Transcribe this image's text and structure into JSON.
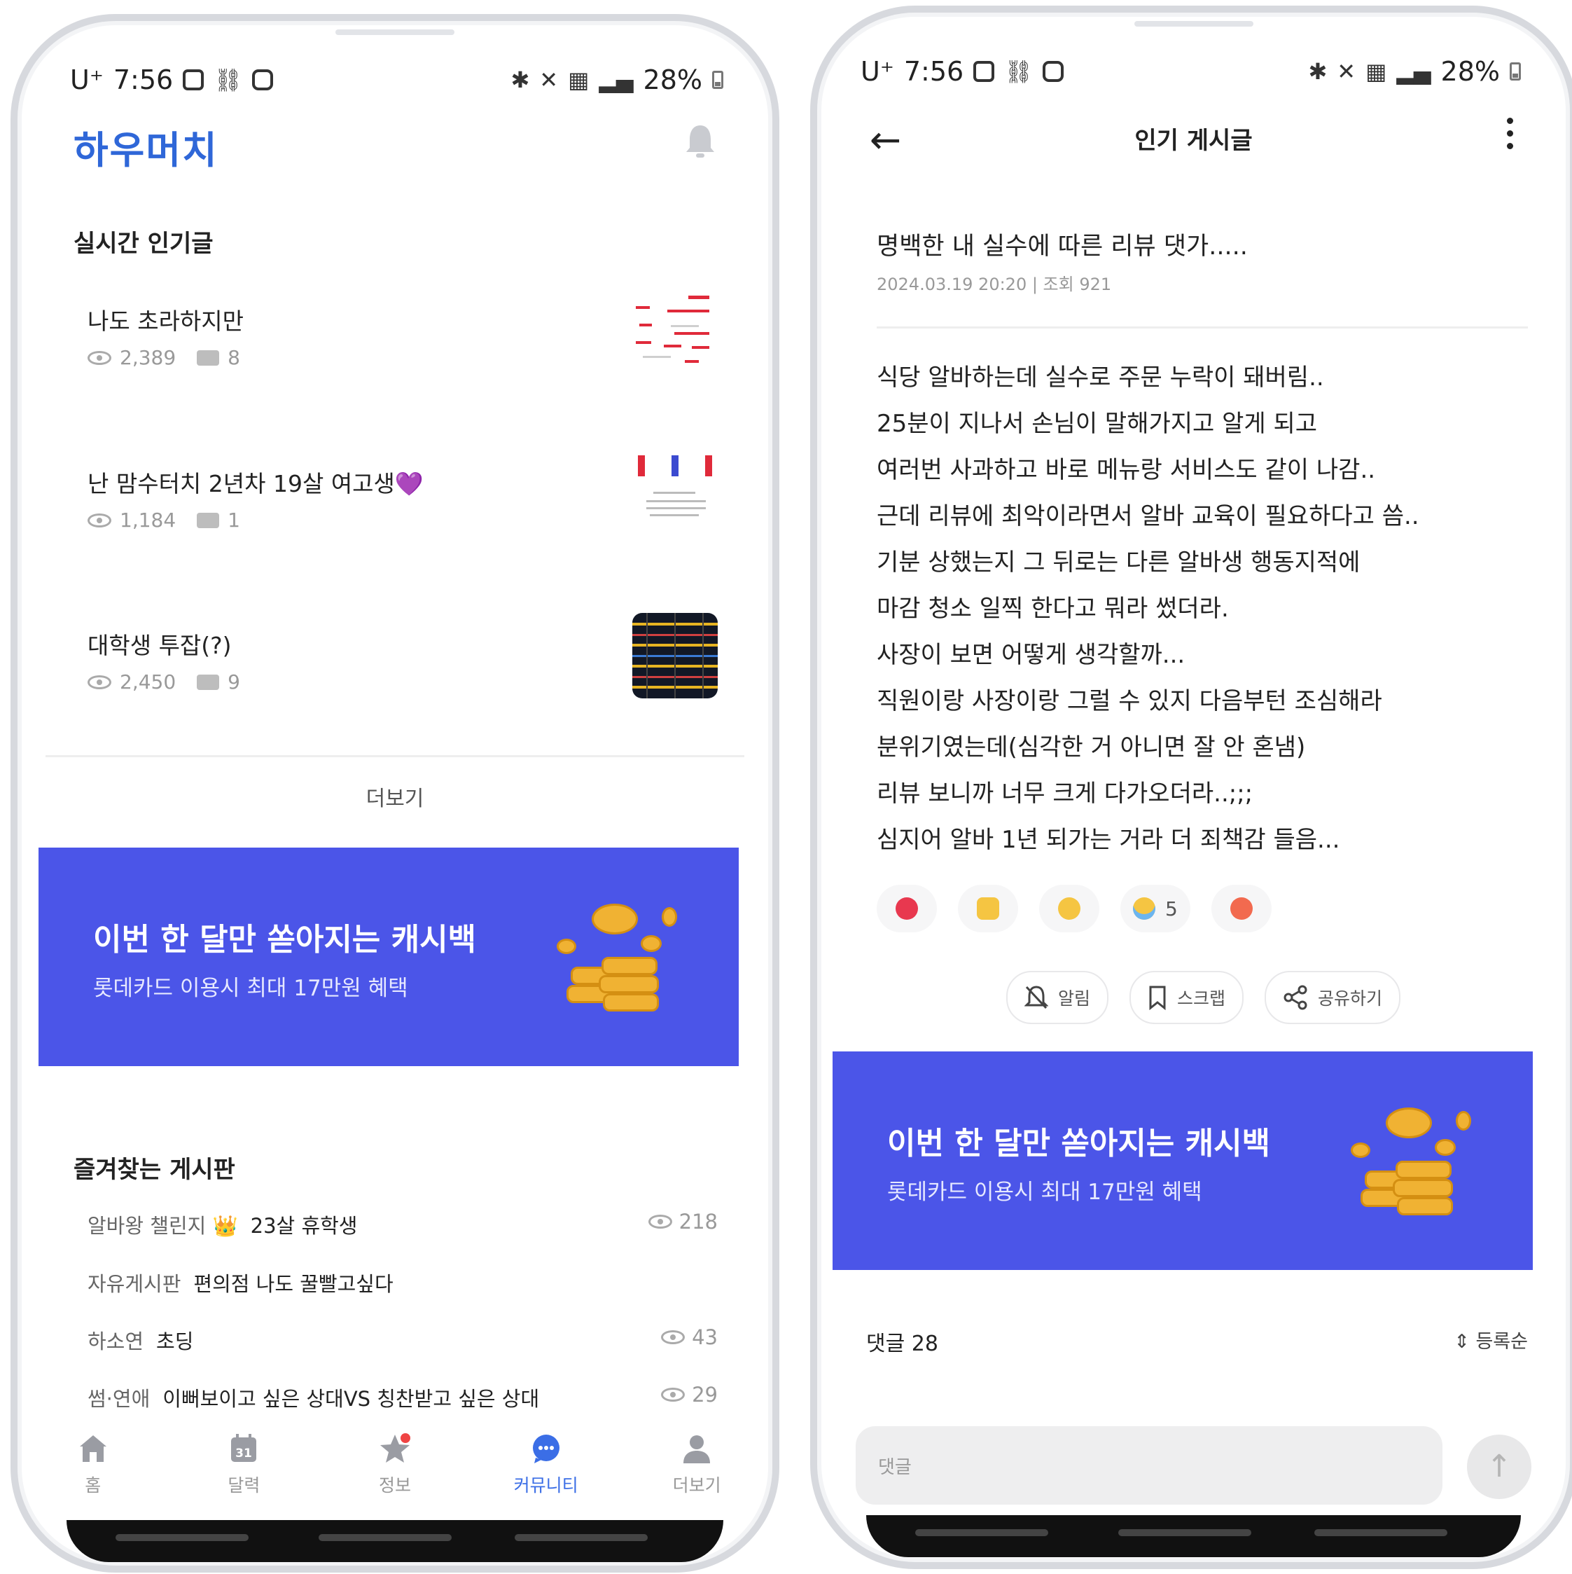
{
  "left": {
    "status": {
      "time": "7:56",
      "carrier": "U⁺",
      "battery": "28%"
    },
    "brand": "하우머치",
    "realtime": {
      "title": "실시간 인기글",
      "posts": [
        {
          "title": "나도 초라하지만",
          "views": "2,389",
          "comments": "8"
        },
        {
          "title": "난 맘수터치 2년차 19살 여고생💜",
          "views": "1,184",
          "comments": "1"
        },
        {
          "title": "대학생 투잡(?)",
          "views": "2,450",
          "comments": "9"
        }
      ],
      "more": "더보기"
    },
    "banner": {
      "title": "이번 한 달만 쏟아지는 캐시백",
      "subtitle": "롯데카드 이용시 최대 17만원 혜택"
    },
    "favorites": {
      "title": "즐겨찾는 게시판",
      "rows": [
        {
          "board": "알바왕 챌린지 👑",
          "title": "23살 휴학생",
          "views": "218"
        },
        {
          "board": "자유게시판",
          "title": "편의점 나도 꿀빨고싶다",
          "views": ""
        },
        {
          "board": "하소연",
          "title": "초딩",
          "views": "43"
        },
        {
          "board": "썸·연애",
          "title": "이뻐보이고 싶은 상대VS 칭찬받고 싶은 상대",
          "views": "29"
        }
      ]
    },
    "tabs": [
      {
        "label": "홈",
        "icon": "home-icon"
      },
      {
        "label": "달력",
        "icon": "calendar-icon",
        "badge": "31"
      },
      {
        "label": "정보",
        "icon": "star-icon"
      },
      {
        "label": "커뮤니티",
        "icon": "chat-icon"
      },
      {
        "label": "더보기",
        "icon": "person-icon"
      }
    ],
    "active_tab": "커뮤니티"
  },
  "right": {
    "status": {
      "time": "7:56",
      "carrier": "U⁺",
      "battery": "28%"
    },
    "header": {
      "title": "인기 게시글"
    },
    "article": {
      "title": "명백한 내 실수에 따른 리뷰 댓가.....",
      "meta": "2024.03.19 20:20 | 조회 921",
      "lines": [
        "식당 알바하는데 실수로 주문 누락이 돼버림..",
        "25분이 지나서 손님이 말해가지고 알게 되고",
        "여러번 사과하고 바로 메뉴랑 서비스도 같이 나감..",
        "근데 리뷰에 최악이라면서 알바 교육이 필요하다고 씀..",
        "기분 상했는지 그 뒤로는 다른 알바생 행동지적에",
        "마감 청소 일찍 한다고 뭐라 썼더라.",
        "사장이 보면 어떻게 생각할까...",
        "직원이랑 사장이랑 그럴 수 있지 다음부턴 조심해라",
        "분위기였는데(심각한 거 아니면 잘 안 혼냄)",
        "리뷰 보니까 너무 크게 다가오더라..;;;",
        "심지어 알바 1년 되가는 거라 더 죄책감 들음..."
      ]
    },
    "reactions": [
      {
        "icon": "heart-emoji",
        "count": ""
      },
      {
        "icon": "thumbs-up-emoji",
        "count": ""
      },
      {
        "icon": "smile-emoji",
        "count": ""
      },
      {
        "icon": "crying-emoji",
        "count": "5"
      },
      {
        "icon": "angry-emoji",
        "count": ""
      }
    ],
    "actions": {
      "notify": "알림",
      "scrap": "스크랩",
      "share": "공유하기"
    },
    "banner": {
      "title": "이번 한 달만 쏟아지는 캐시백",
      "subtitle": "롯데카드 이용시 최대 17만원 혜택"
    },
    "comments": {
      "count_label": "댓글 28",
      "sort": "등록순",
      "input_placeholder": "댓글"
    }
  },
  "colors": {
    "brand": "#2f67d8",
    "banner": "#4b55e8",
    "active_tab": "#3b6ee6"
  }
}
